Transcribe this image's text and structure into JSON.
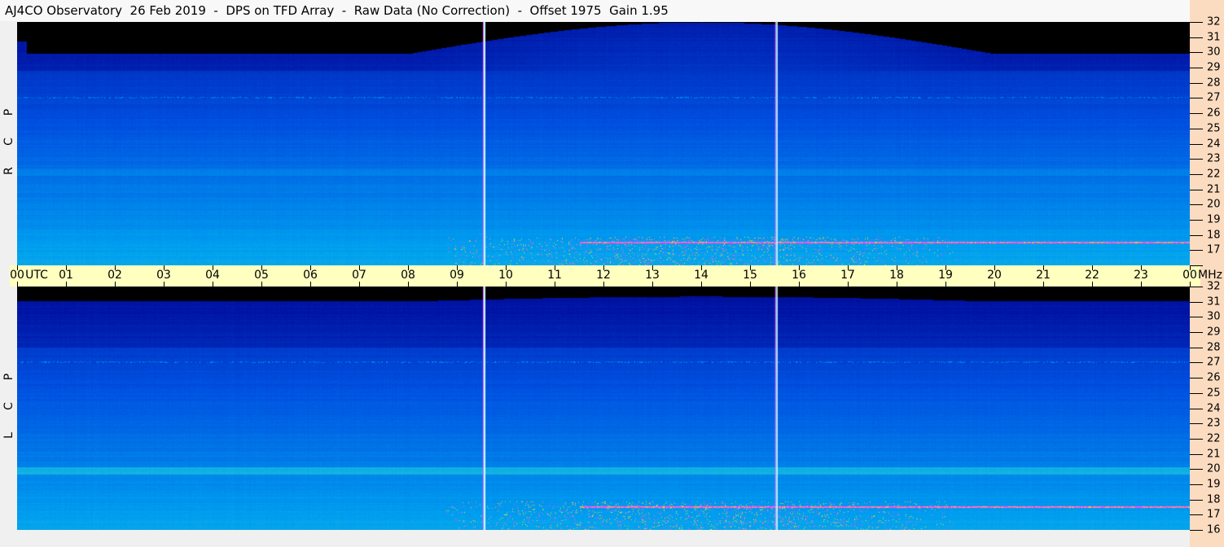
{
  "title": "AJ4CO Observatory  26 Feb 2019  -  DPS on TFD Array  -  Raw Data (No Correction)  -  Offset 1975  Gain 1.95",
  "chart_data": {
    "type": "heatmap",
    "title": "AJ4CO Observatory  26 Feb 2019  -  DPS on TFD Array  -  Raw Data (No Correction)  -  Offset 1975  Gain 1.95",
    "x_axis": {
      "unit": "UTC",
      "range": [
        0,
        24
      ],
      "tick_labels": [
        "00",
        "01",
        "02",
        "03",
        "04",
        "05",
        "06",
        "07",
        "08",
        "09",
        "10",
        "11",
        "12",
        "13",
        "14",
        "15",
        "16",
        "17",
        "18",
        "19",
        "20",
        "21",
        "22",
        "23",
        "00"
      ]
    },
    "y_axis": {
      "unit": "MHz",
      "range": [
        16,
        32
      ],
      "tick_labels": [
        "32",
        "31",
        "30",
        "29",
        "28",
        "27",
        "26",
        "25",
        "24",
        "23",
        "22",
        "21",
        "20",
        "19",
        "18",
        "17",
        "16"
      ]
    },
    "panels": [
      {
        "name": "RCP",
        "label_letters": [
          "R",
          "C",
          "P"
        ]
      },
      {
        "name": "LCP",
        "label_letters": [
          "L",
          "C",
          "P"
        ]
      }
    ],
    "vertical_markers_utc": [
      9.55,
      15.53
    ],
    "colormap": [
      "#000000",
      "#0010a0",
      "#0050e0",
      "#00a0f0",
      "#40e0c0",
      "#f0f000",
      "#ff40ff"
    ]
  },
  "axis": {
    "utc_label": "UTC",
    "mhz_label": "MHz"
  }
}
